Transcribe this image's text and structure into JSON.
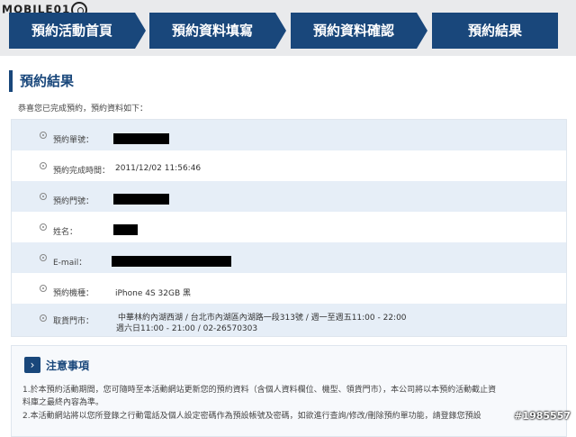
{
  "brand": {
    "logo_text": "MOBILE01"
  },
  "steps": [
    {
      "label": "預約活動首頁"
    },
    {
      "label": "預約資料填寫"
    },
    {
      "label": "預約資料確認"
    },
    {
      "label": "預約結果"
    }
  ],
  "section": {
    "title": "預約結果",
    "intro": "恭喜您已完成預約，預約資料如下："
  },
  "result_rows": [
    {
      "label": "預約單號：",
      "value": "",
      "redacted": true
    },
    {
      "label": "預約完成時間：",
      "value": "2011/12/02 11:56:46",
      "redacted": false
    },
    {
      "label": "預約門號：",
      "value": "",
      "redacted": true
    },
    {
      "label": "姓名：",
      "value": "",
      "redacted": true
    },
    {
      "label": "E-mail：",
      "value": "",
      "redacted": true
    },
    {
      "label": "預約機種：",
      "value": "iPhone 4S 32GB 黑",
      "redacted": false
    },
    {
      "label": "取貨門市：",
      "value": "中華林約內湖西湖 / 台北市內湖區內湖路一段313號 / 週一至週五11:00 - 22:00",
      "value2": "週六日11:00 - 21:00 / 02-26570303",
      "redacted": false
    }
  ],
  "notice": {
    "title": "注意事項",
    "lines": [
      "1.於本預約活動期間，您可隨時至本活動網站更新您的預約資料（含個人資料欄位、機型、領貨門市），本公司將以本預約活動截止資",
      "料庫之最終內容為準。",
      "2.本活動網站將以您所登錄之行動電話及個人設定密碼作為預設帳號及密碼，如欲進行查詢/修改/刪除預約單功能，請登錄您預設"
    ]
  },
  "watermark": "#1985557"
}
